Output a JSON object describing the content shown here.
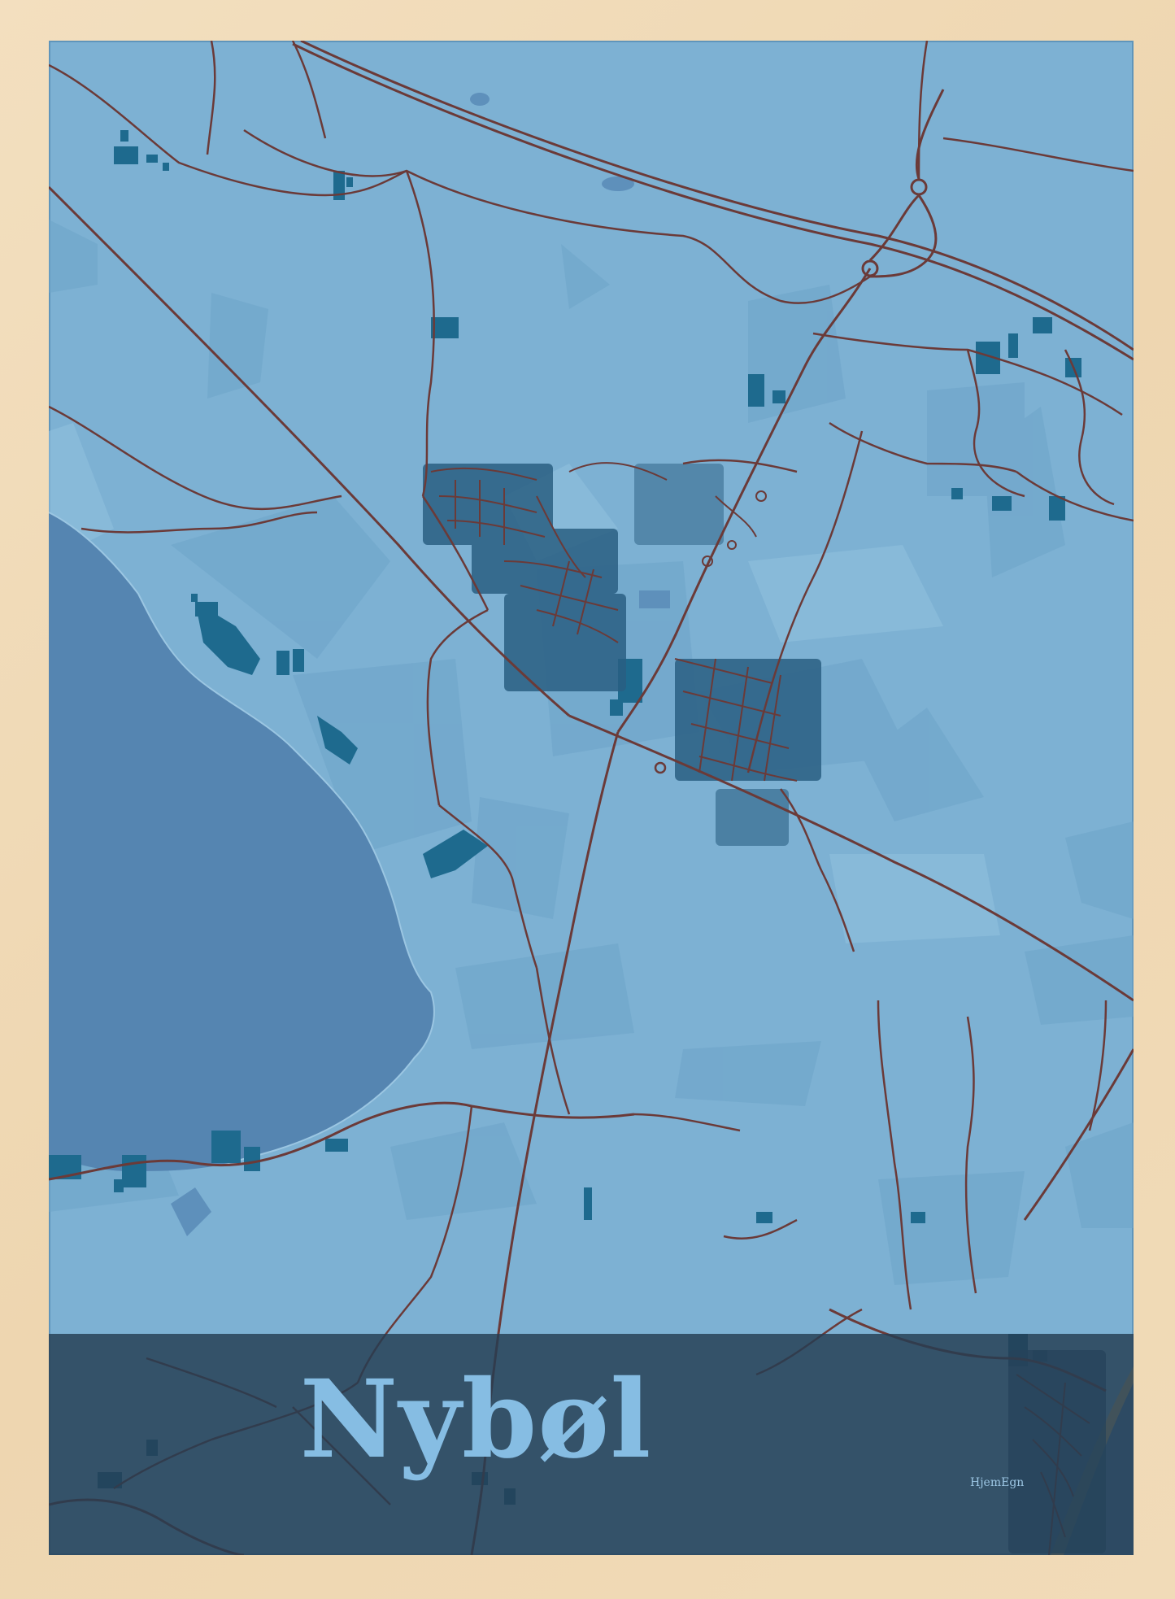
{
  "poster": {
    "title": "Nybøl",
    "brand": "HjemEgn"
  },
  "colors": {
    "frame": "#f1dbb8",
    "land": "#7db1d3",
    "fields_light": "#8abbd9",
    "fields_dark": "#6ea4c9",
    "water": "#5585b1",
    "buildings": "#1e6a8e",
    "roads": "#6b3a38",
    "banner": "#253d52",
    "title_text": "#86bde3",
    "beach": "#c4b27f"
  },
  "map_features": {
    "water_bodies": [
      "fjord",
      "sea-coast"
    ],
    "road_types": [
      "motorway",
      "main-road",
      "local-road",
      "residential-street"
    ],
    "landmarks": [
      "roundabout",
      "town-centre",
      "residential-area",
      "farm-buildings"
    ]
  }
}
